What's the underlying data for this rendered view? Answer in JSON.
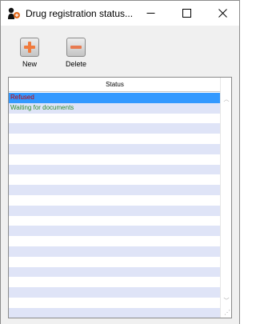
{
  "window": {
    "title": "Drug registration status...",
    "controls": {
      "minimize": "—",
      "maximize": "☐",
      "close": "✕"
    }
  },
  "toolbar": {
    "new_label": "New",
    "delete_label": "Delete"
  },
  "table": {
    "column_header": "Status",
    "rows": [
      {
        "text": "Refused",
        "color": "#cc0000",
        "selected": true
      },
      {
        "text": "Waiting for documents",
        "color": "#2e8b2e",
        "selected": false
      }
    ],
    "empty_rows": 21
  },
  "colors": {
    "selection": "#3399ff",
    "stripe": "#dfe4f7",
    "new_icon": "#f07a3c",
    "delete_icon": "#e87a50"
  }
}
